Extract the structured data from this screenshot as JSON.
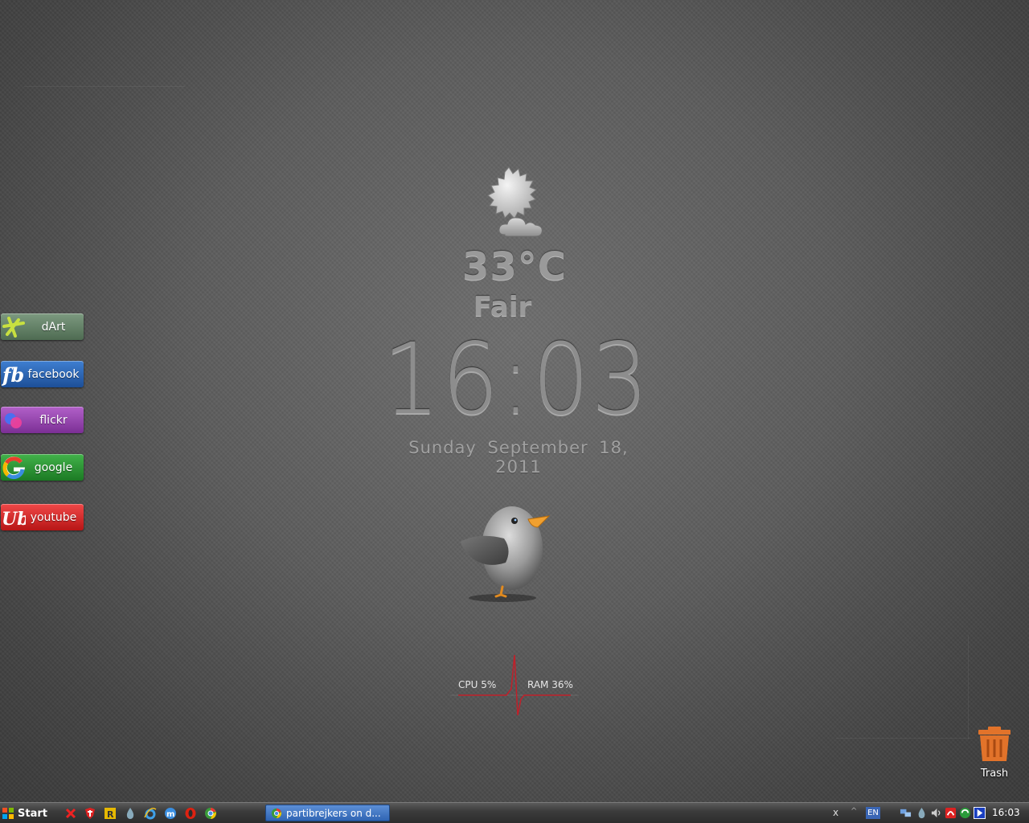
{
  "weather": {
    "temperature": "33°C",
    "condition": "Fair",
    "icon": "sun-cloud-icon"
  },
  "clock": {
    "time": "16:03",
    "day": "Sunday",
    "date": "September 18, 2011"
  },
  "system_meter": {
    "cpu_label": "CPU 5%",
    "ram_label": "RAM 36%",
    "cpu_percent": 5,
    "ram_percent": 36
  },
  "side_buttons": [
    {
      "label": "dArt",
      "color": "#5f7d63"
    },
    {
      "label": "facebook",
      "color": "#2a62b3"
    },
    {
      "label": "flickr",
      "color": "#9645ae"
    },
    {
      "label": "google",
      "color": "#2d9535"
    },
    {
      "label": "youtube",
      "color": "#d62d2d"
    }
  ],
  "trash": {
    "label": "Trash",
    "color": "#e2732a"
  },
  "taskbar": {
    "start_label": "Start",
    "active_task": "partibrejkers on d...",
    "tray_close": "x",
    "tray_arrow": "^",
    "language": "EN",
    "clock": "16:03"
  }
}
